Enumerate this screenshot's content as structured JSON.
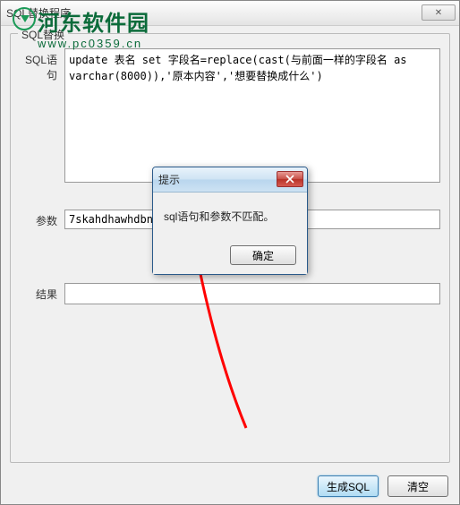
{
  "window": {
    "title": "SQL替换程序",
    "close_symbol": "✕"
  },
  "groupbox": {
    "label": "SQL替换"
  },
  "fields": {
    "sql_label": "SQL语句",
    "sql_value": "update 表名 set 字段名=replace(cast(与前面一样的字段名 as varchar(8000)),'原本内容','想要替换成什么')",
    "params_label": "参数",
    "params_value": "7skahdhawhdbne",
    "result_label": "结果",
    "result_value": ""
  },
  "buttons": {
    "generate": "生成SQL",
    "clear": "清空"
  },
  "dialog": {
    "title": "提示",
    "message": "sql语句和参数不匹配。",
    "ok": "确定"
  },
  "watermark": {
    "text": "河东软件园",
    "url": "www.pc0359.cn"
  }
}
